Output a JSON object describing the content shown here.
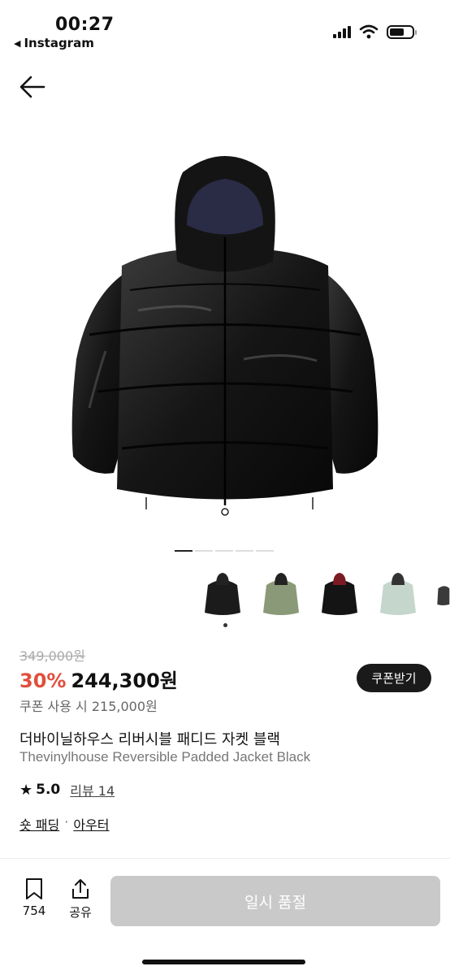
{
  "status_bar": {
    "time": "00:27",
    "back_app": "Instagram"
  },
  "nav": {
    "icons": [
      "arrow-left-icon",
      "search-icon",
      "home-icon",
      "shopping-bag-icon"
    ]
  },
  "gallery": {
    "page_count": 5,
    "active_page": 1
  },
  "color_options": [
    "black",
    "olive",
    "black-red",
    "mint",
    "charcoal"
  ],
  "colors": {
    "accent_red": "#e04f3c",
    "dark": "#1a1a1a",
    "disabled_button": "#c9c9c9"
  },
  "product": {
    "original_price": "349,000원",
    "discount_rate": "30%",
    "sale_price": "244,300원",
    "coupon_button": "쿠폰받기",
    "coupon_price": "쿠폰 사용 시 215,000원",
    "title_ko": "더바이닐하우스 리버시블 패디드 자켓 블랙",
    "title_en": "Thevinylhouse Reversible Padded Jacket Black",
    "rating": "5.0",
    "review_label": "리뷰 14",
    "category_1": "숏 패딩",
    "category_sep": "·",
    "category_2": "아우터"
  },
  "bottom_bar": {
    "save_count": "754",
    "share_label": "공유",
    "buy_button": "일시 품절"
  }
}
